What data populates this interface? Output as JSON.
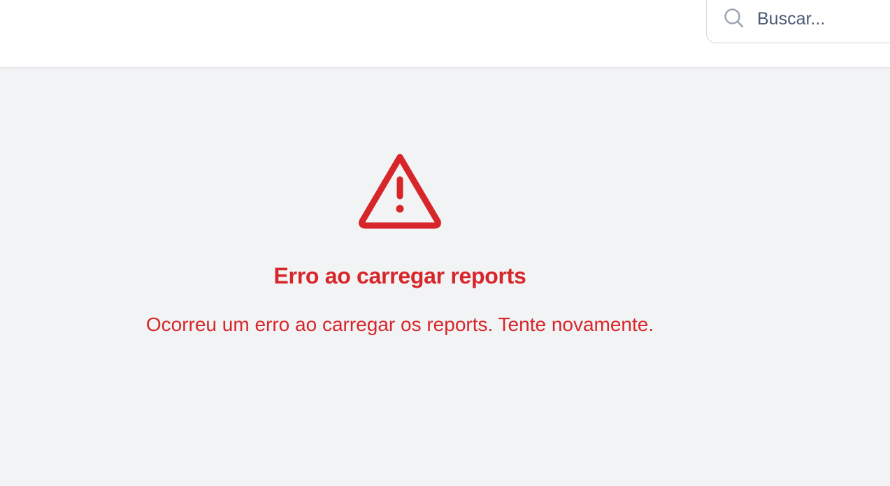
{
  "header": {
    "search": {
      "placeholder": "Buscar...",
      "value": "",
      "icon": "search-icon"
    }
  },
  "error": {
    "icon": "warning-triangle-icon",
    "title": "Erro ao carregar reports",
    "message": "Ocorreu um erro ao carregar os reports. Tente novamente.",
    "color": "#d7262a"
  },
  "colors": {
    "background": "#f2f3f5",
    "header_background": "#ffffff",
    "search_text": "#4a5b73",
    "error": "#d7262a"
  }
}
